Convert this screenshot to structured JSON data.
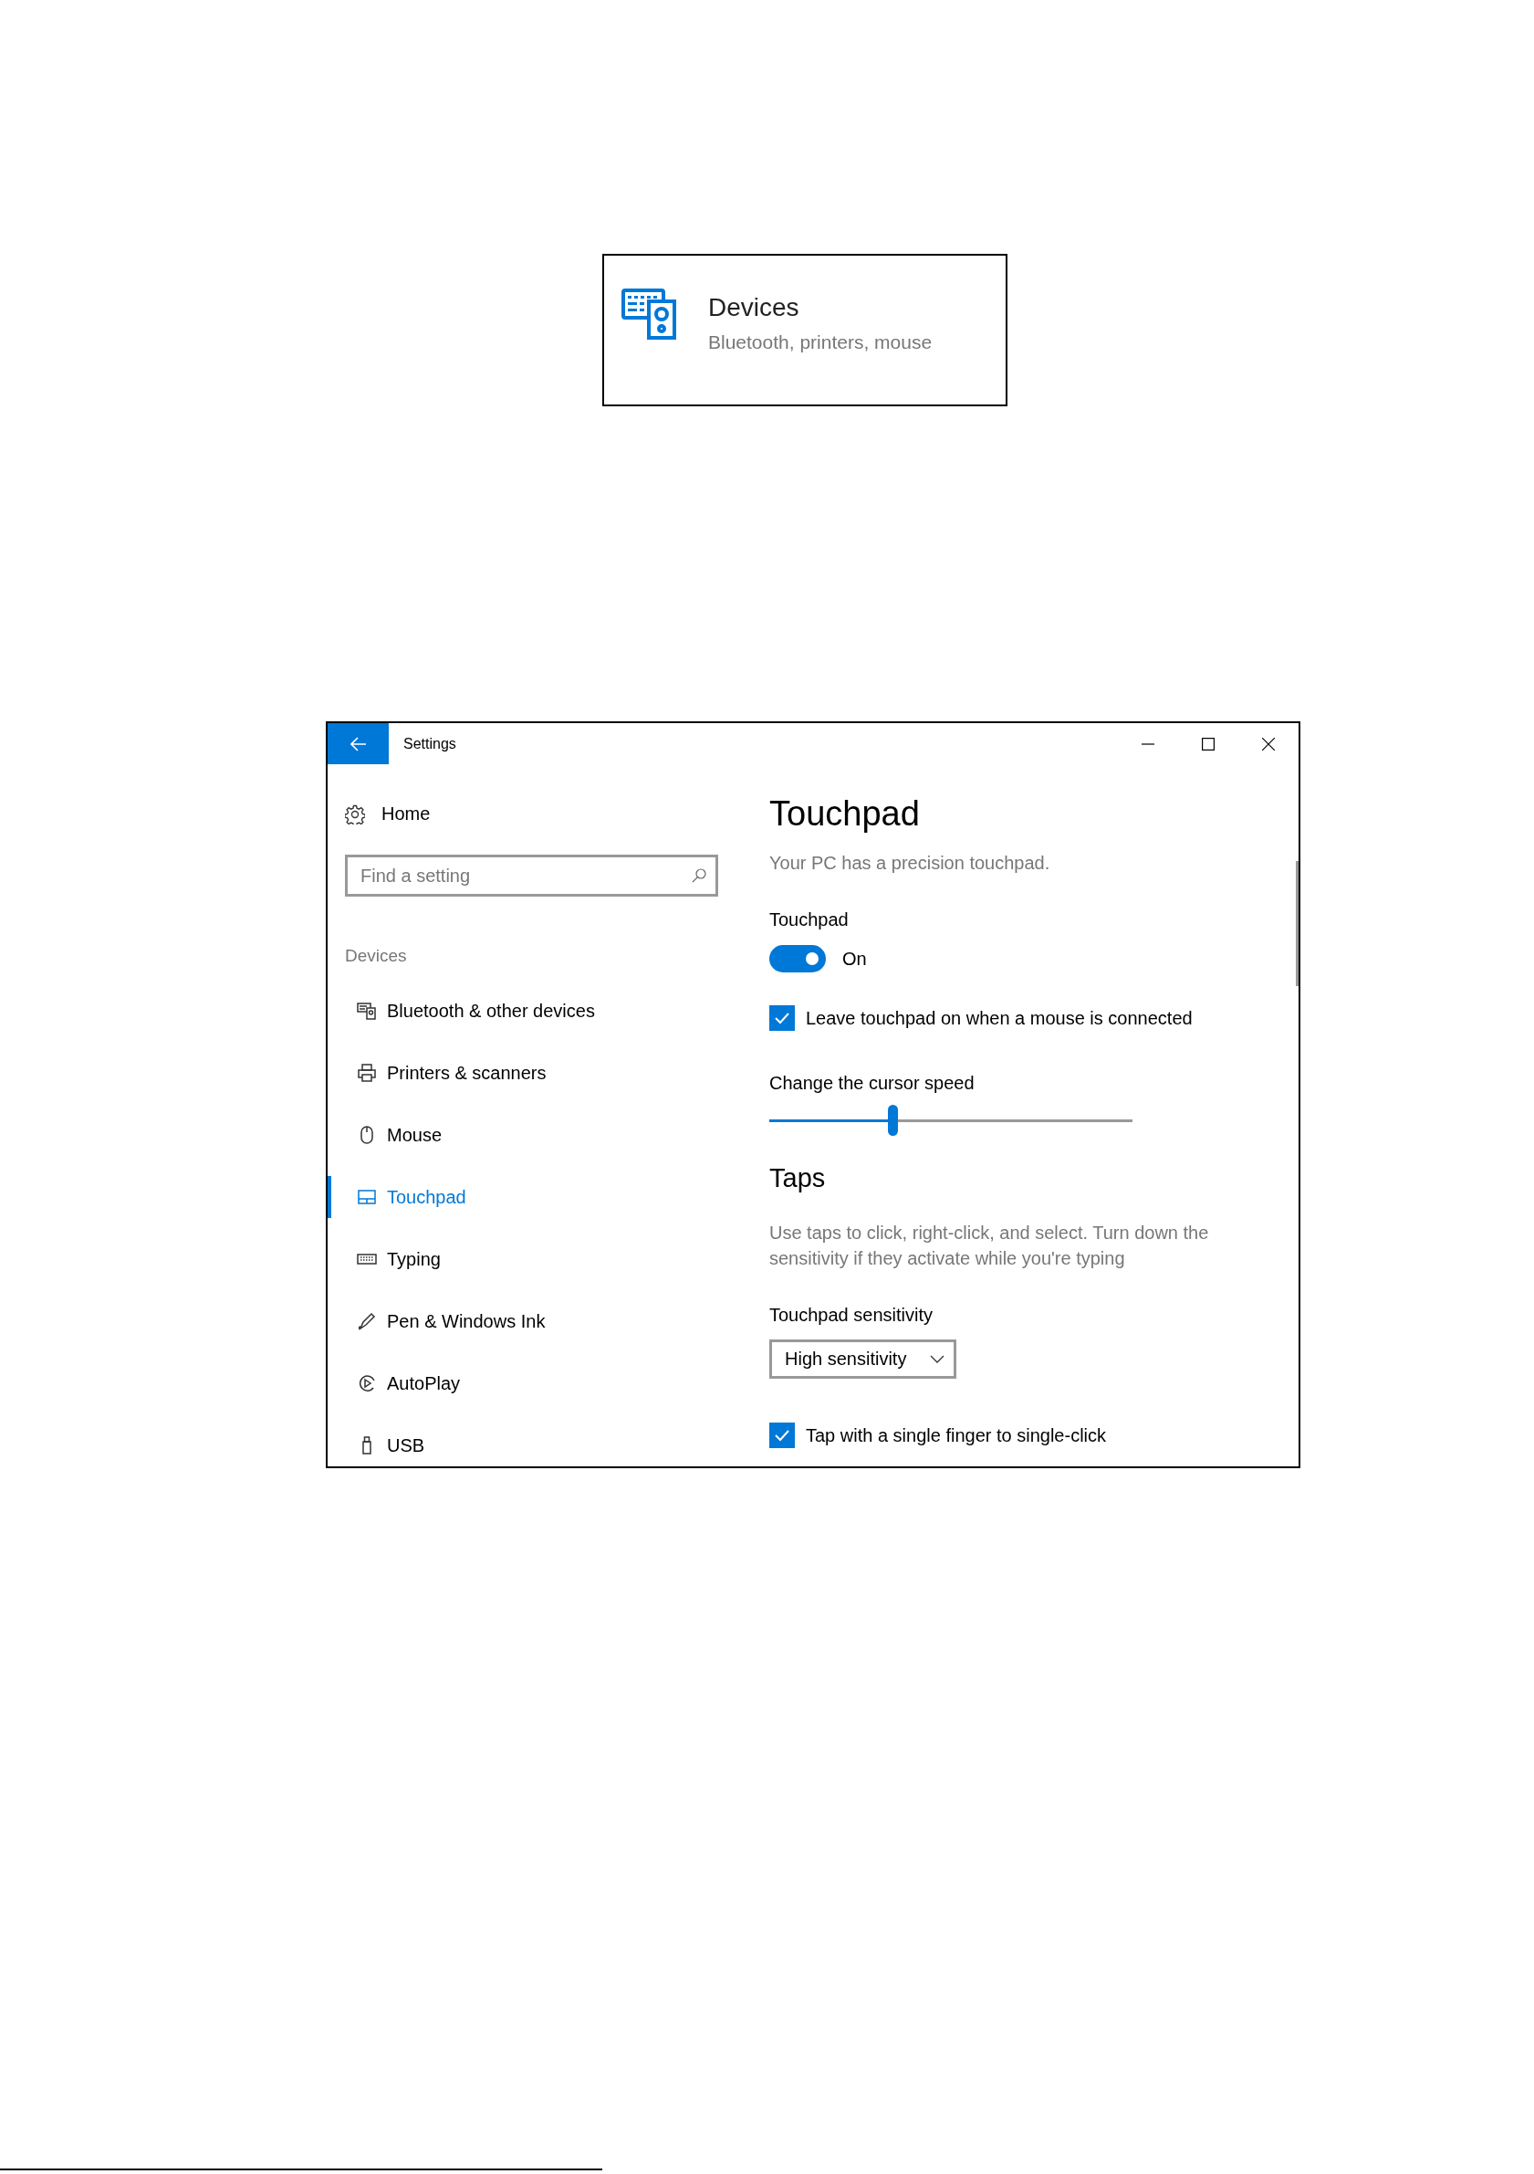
{
  "devices_tile": {
    "title": "Devices",
    "subtitle": "Bluetooth, printers, mouse"
  },
  "window": {
    "title": "Settings"
  },
  "sidebar": {
    "home": "Home",
    "search": {
      "placeholder": "Find a setting"
    },
    "section": "Devices",
    "items": [
      {
        "label": "Bluetooth & other devices",
        "kind": "bluetooth",
        "selected": false
      },
      {
        "label": "Printers & scanners",
        "kind": "printer",
        "selected": false
      },
      {
        "label": "Mouse",
        "kind": "mouse",
        "selected": false
      },
      {
        "label": "Touchpad",
        "kind": "touchpad",
        "selected": true
      },
      {
        "label": "Typing",
        "kind": "keyboard",
        "selected": false
      },
      {
        "label": "Pen & Windows Ink",
        "kind": "pen",
        "selected": false
      },
      {
        "label": "AutoPlay",
        "kind": "autoplay",
        "selected": false
      },
      {
        "label": "USB",
        "kind": "usb",
        "selected": false
      }
    ]
  },
  "content": {
    "title": "Touchpad",
    "subtitle": "Your PC has a precision touchpad.",
    "touchpad_label": "Touchpad",
    "toggle": {
      "on": true,
      "label": "On"
    },
    "leave_on": {
      "label": "Leave touchpad on when a mouse is connected",
      "checked": true
    },
    "speed": {
      "label": "Change the cursor speed",
      "level": 0.34
    },
    "taps_heading": "Taps",
    "taps_description": "Use taps to click, right-click, and select. Turn down the sensitivity if they activate while you're typing",
    "sensitivity": {
      "label": "Touchpad sensitivity",
      "value": "High sensitivity"
    },
    "single_tap": {
      "label": "Tap with a single finger to single-click",
      "checked": true
    }
  }
}
